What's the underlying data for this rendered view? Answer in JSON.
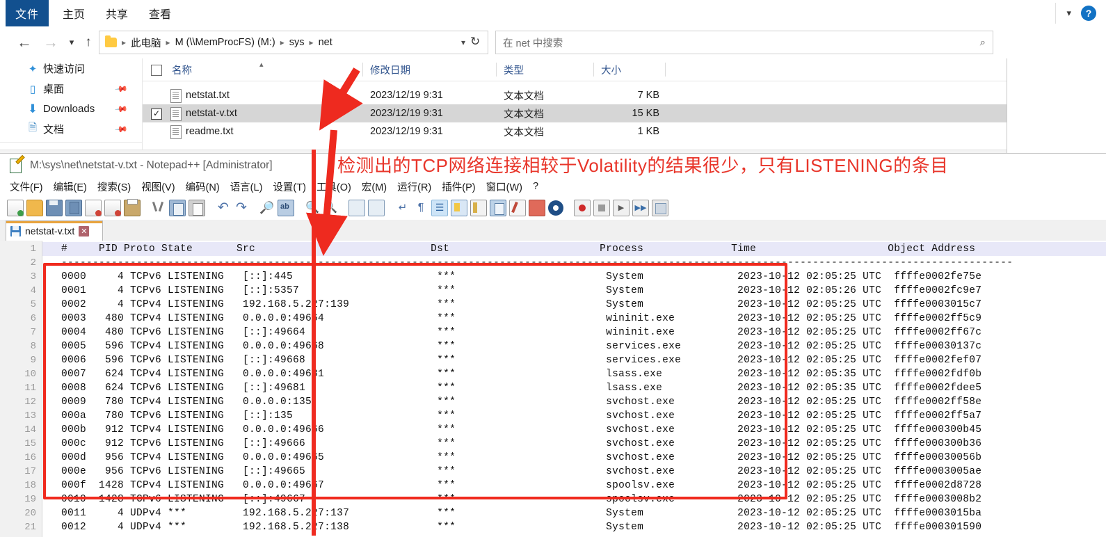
{
  "explorer": {
    "ribbon": {
      "file_tab": "文件",
      "tabs": [
        "主页",
        "共享",
        "查看"
      ],
      "help_icon": "help-icon",
      "chevron_icon": "chevron-up-icon"
    },
    "address": {
      "back_icon": "back-arrow-icon",
      "forward_icon": "forward-arrow-icon",
      "recent_icon": "recent-locations-icon",
      "up_icon": "up-arrow-icon",
      "folder_icon": "folder-icon",
      "crumbs": [
        "此电脑",
        "M (\\\\MemProcFS) (M:)",
        "sys",
        "net"
      ],
      "crumb_caret": "chevron-down-icon",
      "refresh_icon": "refresh-icon",
      "search_placeholder": "在 net 中搜索",
      "search_icon": "search-icon"
    },
    "sidebar": {
      "items": [
        {
          "label": "快速访问",
          "icon": "star-icon",
          "pinned": false
        },
        {
          "label": "桌面",
          "icon": "desktop-icon",
          "pinned": true
        },
        {
          "label": "Downloads",
          "icon": "download-icon",
          "pinned": true
        },
        {
          "label": "文档",
          "icon": "documents-icon",
          "pinned": true
        }
      ]
    },
    "filelist": {
      "columns": [
        "名称",
        "修改日期",
        "类型",
        "大小"
      ],
      "rows": [
        {
          "name": "netstat.txt",
          "date": "2023/12/19 9:31",
          "type": "文本文档",
          "size": "7 KB",
          "selected": false,
          "checked": false
        },
        {
          "name": "netstat-v.txt",
          "date": "2023/12/19 9:31",
          "type": "文本文档",
          "size": "15 KB",
          "selected": true,
          "checked": true
        },
        {
          "name": "readme.txt",
          "date": "2023/12/19 9:31",
          "type": "文本文档",
          "size": "1 KB",
          "selected": false,
          "checked": false
        }
      ]
    }
  },
  "notepad": {
    "title": "M:\\sys\\net\\netstat-v.txt - Notepad++ [Administrator]",
    "menu": [
      "文件(F)",
      "编辑(E)",
      "搜索(S)",
      "视图(V)",
      "编码(N)",
      "语言(L)",
      "设置(T)",
      "工具(O)",
      "宏(M)",
      "运行(R)",
      "插件(P)",
      "窗口(W)",
      "?"
    ],
    "tab": {
      "label": "netstat-v.txt",
      "close_icon": "close-icon",
      "save_icon": "save-icon"
    },
    "toolbar_icons": [
      "new-file-icon",
      "open-file-icon",
      "save-icon",
      "save-all-icon",
      "close-file-icon",
      "close-all-icon",
      "print-icon",
      "cut-icon",
      "copy-icon",
      "paste-icon",
      "undo-icon",
      "redo-icon",
      "find-icon",
      "replace-icon",
      "zoom-in-icon",
      "zoom-out-icon",
      "sync-vertical-icon",
      "sync-horizontal-icon",
      "word-wrap-icon",
      "show-all-chars-icon",
      "indent-guide-icon",
      "ui-lightness-icon",
      "document-map-icon",
      "document-list-icon",
      "function-list-icon",
      "folder-as-workspace-icon",
      "monitor-icon",
      "record-macro-icon",
      "stop-macro-icon",
      "play-macro-icon",
      "fast-play-macro-icon",
      "save-macro-icon"
    ]
  },
  "code": {
    "line_numbers": [
      "1",
      "2",
      "3",
      "4",
      "5",
      "6",
      "7",
      "8",
      "9",
      "10",
      "11",
      "12",
      "13",
      "14",
      "15",
      "16",
      "17",
      "18",
      "19",
      "20",
      "21"
    ],
    "header": "   #    PID Proto  State       Src                            Dst                        Process              Time                     Object Address",
    "separator": "---------------------------------------------------------------------------------------------------------------------------------------------------",
    "columns": [
      "#",
      "PID",
      "Proto",
      "State",
      "Src",
      "Dst",
      "Process",
      "Time",
      "Object Address"
    ],
    "rows": [
      {
        "idx": "0000",
        "pid": "4",
        "proto": "TCPv6",
        "state": "LISTENING",
        "src": "[::]:445",
        "dst": "***",
        "process": "System",
        "time": "2023-10-12 02:05:25 UTC",
        "addr": "ffffe0002fe75e"
      },
      {
        "idx": "0001",
        "pid": "4",
        "proto": "TCPv6",
        "state": "LISTENING",
        "src": "[::]:5357",
        "dst": "***",
        "process": "System",
        "time": "2023-10-12 02:05:26 UTC",
        "addr": "ffffe0002fc9e7"
      },
      {
        "idx": "0002",
        "pid": "4",
        "proto": "TCPv4",
        "state": "LISTENING",
        "src": "192.168.5.227:139",
        "dst": "***",
        "process": "System",
        "time": "2023-10-12 02:05:25 UTC",
        "addr": "ffffe0003015c7"
      },
      {
        "idx": "0003",
        "pid": "480",
        "proto": "TCPv4",
        "state": "LISTENING",
        "src": "0.0.0.0:49664",
        "dst": "***",
        "process": "wininit.exe",
        "time": "2023-10-12 02:05:25 UTC",
        "addr": "ffffe0002ff5c9"
      },
      {
        "idx": "0004",
        "pid": "480",
        "proto": "TCPv6",
        "state": "LISTENING",
        "src": "[::]:49664",
        "dst": "***",
        "process": "wininit.exe",
        "time": "2023-10-12 02:05:25 UTC",
        "addr": "ffffe0002ff67c"
      },
      {
        "idx": "0005",
        "pid": "596",
        "proto": "TCPv4",
        "state": "LISTENING",
        "src": "0.0.0.0:49668",
        "dst": "***",
        "process": "services.exe",
        "time": "2023-10-12 02:05:25 UTC",
        "addr": "ffffe00030137c"
      },
      {
        "idx": "0006",
        "pid": "596",
        "proto": "TCPv6",
        "state": "LISTENING",
        "src": "[::]:49668",
        "dst": "***",
        "process": "services.exe",
        "time": "2023-10-12 02:05:25 UTC",
        "addr": "ffffe0002fef07"
      },
      {
        "idx": "0007",
        "pid": "624",
        "proto": "TCPv4",
        "state": "LISTENING",
        "src": "0.0.0.0:49681",
        "dst": "***",
        "process": "lsass.exe",
        "time": "2023-10-12 02:05:35 UTC",
        "addr": "ffffe0002fdf0b"
      },
      {
        "idx": "0008",
        "pid": "624",
        "proto": "TCPv6",
        "state": "LISTENING",
        "src": "[::]:49681",
        "dst": "***",
        "process": "lsass.exe",
        "time": "2023-10-12 02:05:35 UTC",
        "addr": "ffffe0002fdee5"
      },
      {
        "idx": "0009",
        "pid": "780",
        "proto": "TCPv4",
        "state": "LISTENING",
        "src": "0.0.0.0:135",
        "dst": "***",
        "process": "svchost.exe",
        "time": "2023-10-12 02:05:25 UTC",
        "addr": "ffffe0002ff58e"
      },
      {
        "idx": "000a",
        "pid": "780",
        "proto": "TCPv6",
        "state": "LISTENING",
        "src": "[::]:135",
        "dst": "***",
        "process": "svchost.exe",
        "time": "2023-10-12 02:05:25 UTC",
        "addr": "ffffe0002ff5a7"
      },
      {
        "idx": "000b",
        "pid": "912",
        "proto": "TCPv4",
        "state": "LISTENING",
        "src": "0.0.0.0:49666",
        "dst": "***",
        "process": "svchost.exe",
        "time": "2023-10-12 02:05:25 UTC",
        "addr": "ffffe000300b45"
      },
      {
        "idx": "000c",
        "pid": "912",
        "proto": "TCPv6",
        "state": "LISTENING",
        "src": "[::]:49666",
        "dst": "***",
        "process": "svchost.exe",
        "time": "2023-10-12 02:05:25 UTC",
        "addr": "ffffe000300b36"
      },
      {
        "idx": "000d",
        "pid": "956",
        "proto": "TCPv4",
        "state": "LISTENING",
        "src": "0.0.0.0:49665",
        "dst": "***",
        "process": "svchost.exe",
        "time": "2023-10-12 02:05:25 UTC",
        "addr": "ffffe00030056b"
      },
      {
        "idx": "000e",
        "pid": "956",
        "proto": "TCPv6",
        "state": "LISTENING",
        "src": "[::]:49665",
        "dst": "***",
        "process": "svchost.exe",
        "time": "2023-10-12 02:05:25 UTC",
        "addr": "ffffe0003005ae"
      },
      {
        "idx": "000f",
        "pid": "1428",
        "proto": "TCPv4",
        "state": "LISTENING",
        "src": "0.0.0.0:49667",
        "dst": "***",
        "process": "spoolsv.exe",
        "time": "2023-10-12 02:05:25 UTC",
        "addr": "ffffe0002d8728"
      },
      {
        "idx": "0010",
        "pid": "1428",
        "proto": "TCPv6",
        "state": "LISTENING",
        "src": "[::]:49667",
        "dst": "***",
        "process": "spoolsv.exe",
        "time": "2023-10-12 02:05:25 UTC",
        "addr": "ffffe0003008b2"
      },
      {
        "idx": "0011",
        "pid": "4",
        "proto": "UDPv4",
        "state": "***",
        "src": "192.168.5.227:137",
        "dst": "***",
        "process": "System",
        "time": "2023-10-12 02:05:25 UTC",
        "addr": "ffffe0003015ba"
      },
      {
        "idx": "0012",
        "pid": "4",
        "proto": "UDPv4",
        "state": "***",
        "src": "192.168.5.227:138",
        "dst": "***",
        "process": "System",
        "time": "2023-10-12 02:05:25 UTC",
        "addr": "ffffe000301590"
      }
    ]
  },
  "annotation": {
    "text": "检测出的TCP网络连接相较于Volatility的结果很少，只有LISTENING的条目",
    "color": "#e8352a",
    "box_color": "#f02a1e",
    "arrow_color": "#ee2a1f"
  }
}
